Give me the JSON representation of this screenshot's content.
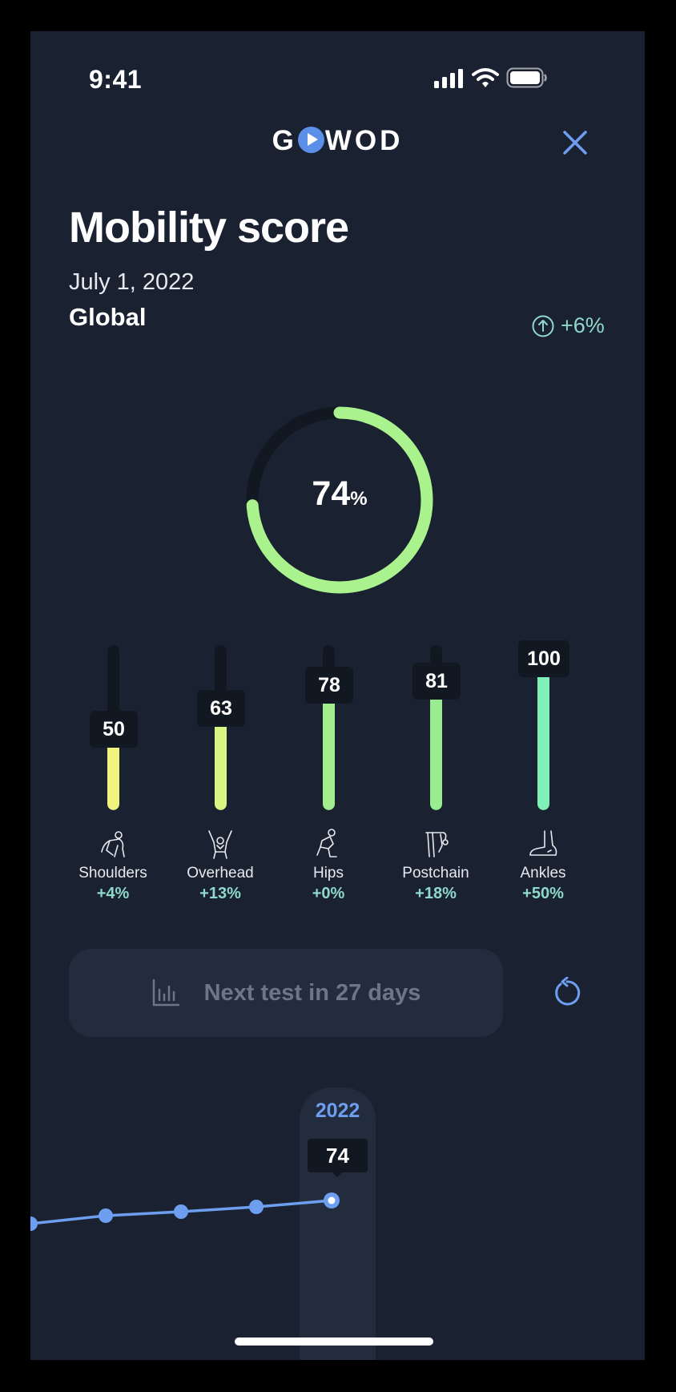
{
  "status_bar": {
    "time": "9:41"
  },
  "header": {
    "logo_prefix": "G",
    "logo_suffix": "WOD"
  },
  "page": {
    "title": "Mobility score",
    "date": "July 1, 2022",
    "scope": "Global",
    "global_delta": "+6%"
  },
  "score": {
    "value": "74",
    "unit": "%",
    "fraction": 0.74
  },
  "colors": {
    "background": "#1a2130",
    "accent_blue": "#5b8fe8",
    "delta_teal": "#8fd9cc",
    "ring_green": "#a9f28e",
    "shoulders": "#f1f47c",
    "overhead": "#d9f584",
    "hips": "#a3ee8c",
    "postchain": "#98ed90",
    "ankles": "#7ff0b8"
  },
  "categories": [
    {
      "name": "Shoulders",
      "value": "50",
      "delta": "+4%",
      "icon": "shoulders-stretch-icon"
    },
    {
      "name": "Overhead",
      "value": "63",
      "delta": "+13%",
      "icon": "overhead-reach-icon"
    },
    {
      "name": "Hips",
      "value": "78",
      "delta": "+0%",
      "icon": "hips-squat-icon"
    },
    {
      "name": "Postchain",
      "value": "81",
      "delta": "+18%",
      "icon": "forward-fold-icon"
    },
    {
      "name": "Ankles",
      "value": "100",
      "delta": "+50%",
      "icon": "foot-icon"
    }
  ],
  "next_test": {
    "label": "Next test in 27 days",
    "icon": "bar-chart-icon"
  },
  "history": {
    "selected_year": "2022",
    "selected_value": "74"
  }
}
